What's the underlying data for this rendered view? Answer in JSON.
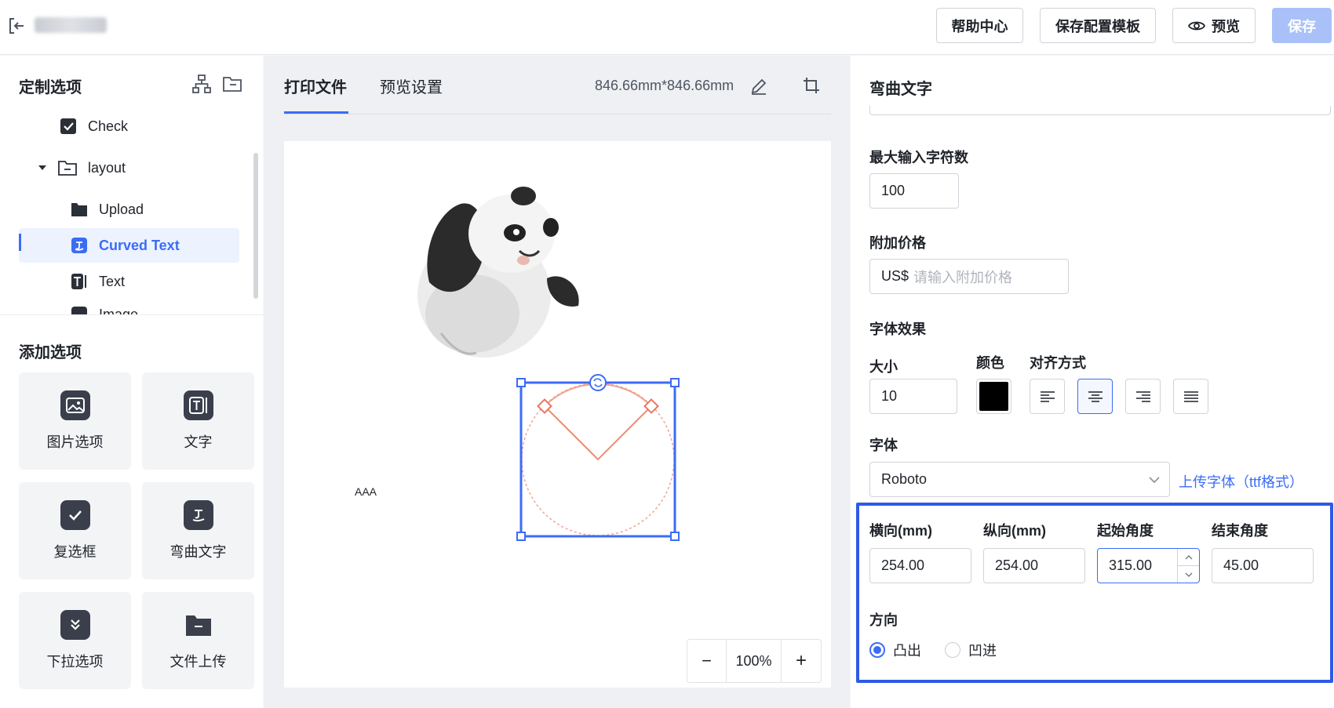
{
  "topbar": {
    "help_label": "帮助中心",
    "save_template_label": "保存配置模板",
    "preview_label": "预览",
    "save_label": "保存"
  },
  "left": {
    "custom_title": "定制选项",
    "tree": [
      {
        "label": "Check",
        "icon": "checkbox-icon"
      },
      {
        "label": "layout",
        "icon": "folder-icon"
      },
      {
        "label": "Upload",
        "icon": "folder-fill-icon"
      },
      {
        "label": "Curved Text",
        "icon": "curved-text-icon",
        "selected": true
      },
      {
        "label": "Text",
        "icon": "text-icon"
      },
      {
        "label": "Image",
        "icon": "image-icon"
      }
    ],
    "add_title": "添加选项",
    "cards": [
      {
        "label": "图片选项",
        "icon": "image-icon"
      },
      {
        "label": "文字",
        "icon": "text-icon"
      },
      {
        "label": "复选框",
        "icon": "checkbox-icon"
      },
      {
        "label": "弯曲文字",
        "icon": "curved-text-icon"
      },
      {
        "label": "下拉选项",
        "icon": "dropdown-icon"
      },
      {
        "label": "文件上传",
        "icon": "folder-icon"
      }
    ]
  },
  "middle": {
    "tab_print": "打印文件",
    "tab_preview": "预览设置",
    "dimensions": "846.66mm*846.66mm",
    "canvas_text": "AAA",
    "zoom_minus": "−",
    "zoom_level": "100%",
    "zoom_plus": "+"
  },
  "right": {
    "title": "弯曲文字",
    "max_chars_label": "最大输入字符数",
    "max_chars_value": "100",
    "extra_price_label": "附加价格",
    "currency": "US$",
    "extra_price_placeholder": "请输入附加价格",
    "font_effect_label": "字体效果",
    "size_label": "大小",
    "size_value": "10",
    "color_label": "颜色",
    "color_value": "#000000",
    "align_label": "对齐方式",
    "font_label": "字体",
    "font_value": "Roboto",
    "upload_font_link": "上传字体（ttf格式）",
    "horizontal_label": "横向(mm)",
    "horizontal_value": "254.00",
    "vertical_label": "纵向(mm)",
    "vertical_value": "254.00",
    "start_angle_label": "起始角度",
    "start_angle_value": "315.00",
    "end_angle_label": "结束角度",
    "end_angle_value": "45.00",
    "direction_label": "方向",
    "direction_convex": "凸出",
    "direction_concave": "凹进"
  },
  "colors": {
    "accent": "#3b6cf6",
    "highlight": "#2d5ae6",
    "primary_disabled": "#a9c1f8"
  }
}
